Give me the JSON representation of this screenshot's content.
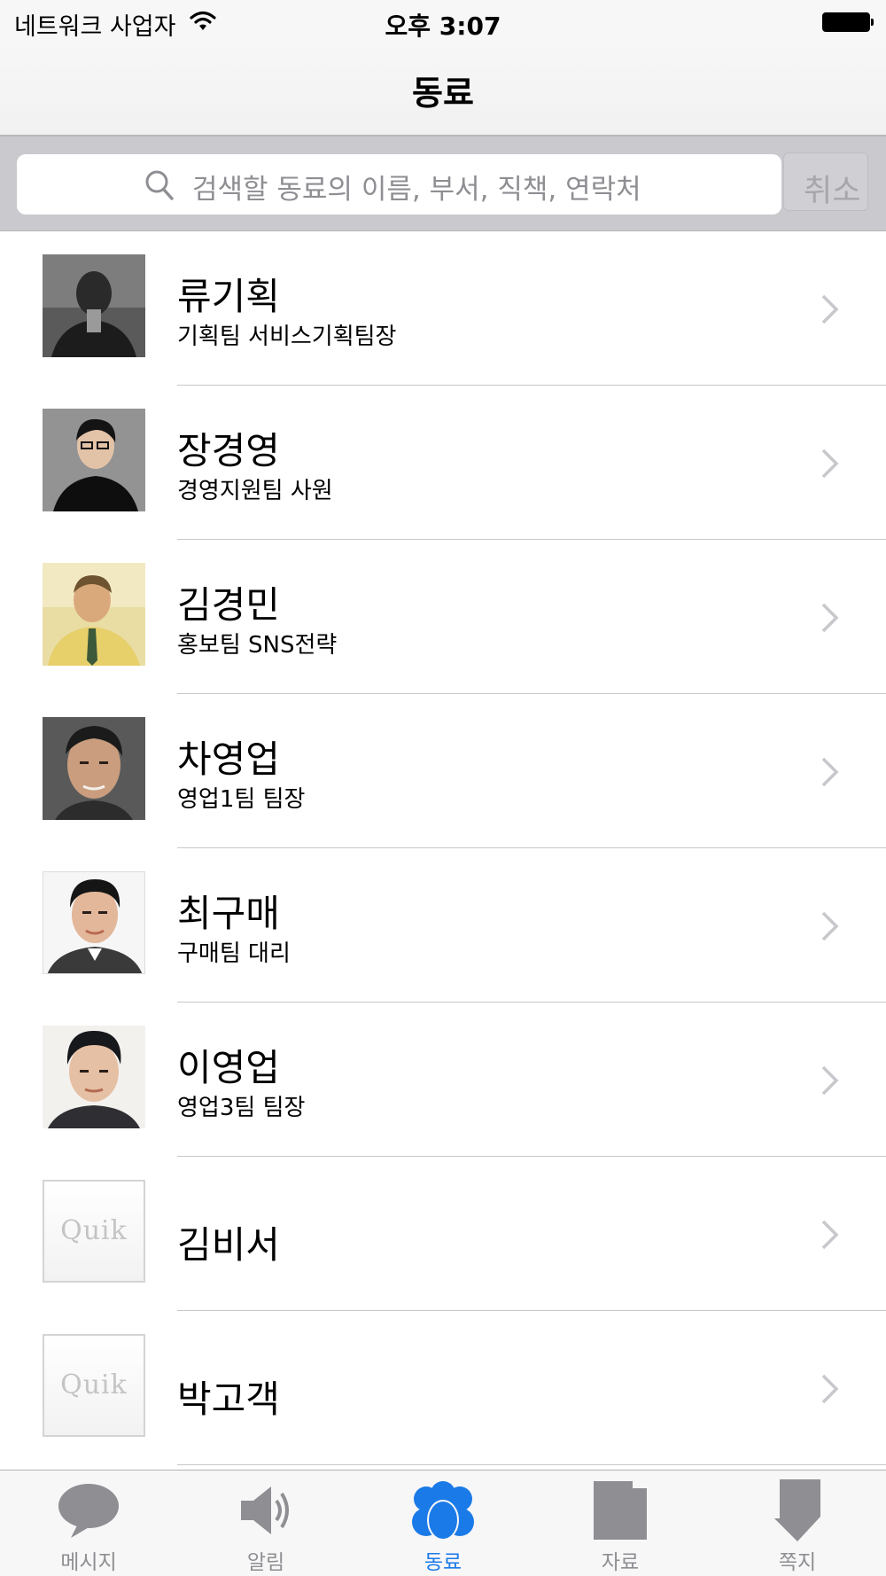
{
  "status_bar": {
    "carrier": "네트워크 사업자",
    "time": "오후 3:07"
  },
  "nav": {
    "title": "동료"
  },
  "search": {
    "placeholder": "검색할 동료의 이름, 부서, 직책, 연락처",
    "cancel_label": "취소"
  },
  "colleagues": [
    {
      "name": "류기획",
      "title": "기획팀 서비스기획팀장",
      "photo": "photo-dark-selfie"
    },
    {
      "name": "장경영",
      "title": "경영지원팀 사원",
      "photo": "photo-man-glasses"
    },
    {
      "name": "김경민",
      "title": "홍보팀 SNS전략",
      "photo": "photo-man-yellow-shirt"
    },
    {
      "name": "차영업",
      "title": "영업1팀 팀장",
      "photo": "photo-man-portrait"
    },
    {
      "name": "최구매",
      "title": "구매팀 대리",
      "photo": "photo-man-suit"
    },
    {
      "name": "이영업",
      "title": "영업3팀 팀장",
      "photo": "photo-man-id"
    },
    {
      "name": "김비서",
      "title": "",
      "photo": "quik-placeholder",
      "logo_text": "Quik"
    },
    {
      "name": "박고객",
      "title": "",
      "photo": "quik-placeholder",
      "logo_text": "Quik"
    }
  ],
  "tabs": [
    {
      "label": "메시지",
      "icon": "speech-bubble-icon",
      "active": false
    },
    {
      "label": "알림",
      "icon": "speaker-icon",
      "active": false
    },
    {
      "label": "동료",
      "icon": "people-icon",
      "active": true
    },
    {
      "label": "자료",
      "icon": "document-icon",
      "active": false
    },
    {
      "label": "쪽지",
      "icon": "note-arrow-icon",
      "active": false
    }
  ],
  "colors": {
    "accent": "#1a7ae8",
    "inactive_tab": "#8e8e93",
    "search_background": "#c9c9ce"
  }
}
